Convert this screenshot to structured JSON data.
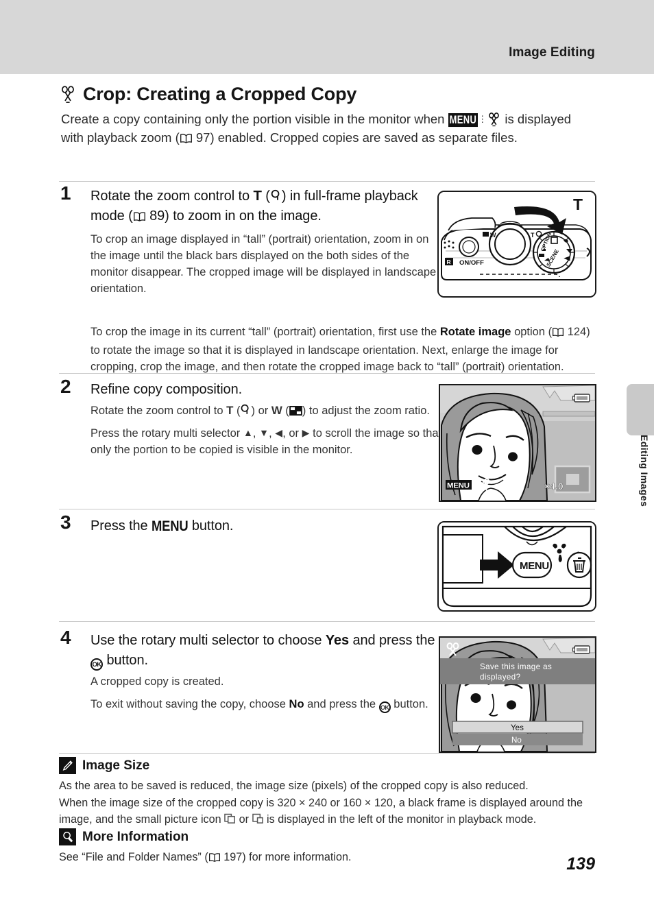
{
  "header": {
    "title": "Image Editing"
  },
  "side_tab": {
    "label": "Editing Images"
  },
  "section": {
    "icon": "scissors-icon",
    "title": "Crop: Creating a Cropped Copy",
    "intro_part1": "Create a copy containing only the portion visible in the monitor when ",
    "intro_part2": " is displayed with playback zoom (",
    "intro_page_ref": "97",
    "intro_part3": ") enabled. Cropped copies are saved as separate files."
  },
  "steps": [
    {
      "number": "1",
      "head_a": "Rotate the zoom control to ",
      "head_T": "T",
      "head_b": " (",
      "head_zoomicon": "magnifier-icon",
      "head_c": ") in full-frame playback mode (",
      "head_page_ref": "89",
      "head_d": ") to zoom in on the image.",
      "paras": [
        "To crop an image displayed in “tall” (portrait) orientation, zoom in on the image until the black bars displayed on the both sides of the monitor disappear. The cropped image will be displayed in landscape orientation.",
        "To crop the image in its current “tall” (portrait) orientation, first use the Rotate image option (\u0001 124) to rotate the image so that it is displayed in landscape orientation. Next, enlarge the image for cropping, crop the image, and then rotate the cropped image back to “tall” (portrait) orientation."
      ],
      "para2_bold": "Rotate image",
      "para2_page_ref": "124",
      "figure": {
        "name": "camera-top-zoom-control",
        "label_T": "T",
        "onoff_label": "ON/OFF",
        "mode_dial_label": "SCENE"
      }
    },
    {
      "number": "2",
      "head": "Refine copy composition.",
      "para1_a": "Rotate the zoom control to ",
      "para1_T": "T",
      "para1_b": " (",
      "para1_c": ") or ",
      "para1_W": "W",
      "para1_d": " (",
      "para1_e": ") to adjust the zoom ratio.",
      "para2_a": "Press the rotary multi selector ",
      "para2_b": ", ",
      "para2_c": ", ",
      "para2_d": ", or ",
      "para2_e": " to scroll the image so that only the portion to be copied is visible in the monitor.",
      "figure": {
        "name": "monitor-playback-zoom",
        "menu_badge": "MENU",
        "crop_icon": "scissors-icon",
        "zoom_ratio": "×4.0",
        "battery_icon": "battery-icon",
        "nav_thumb": "zoom-position-indicator"
      }
    },
    {
      "number": "3",
      "head_a": "Press the ",
      "head_menu": "MENU",
      "head_b": " button.",
      "figure": {
        "name": "camera-back-menu-button",
        "menu_button": "MENU",
        "macro_icon": "macro-flower-icon",
        "delete_icon": "trash-icon",
        "arrow": "right-arrow-icon"
      }
    },
    {
      "number": "4",
      "head_a": "Use the rotary multi selector to choose ",
      "head_yes": "Yes",
      "head_b": " and press the ",
      "head_ok": "OK",
      "head_c": " button.",
      "para1": "A cropped copy is created.",
      "para2_a": "To exit without saving the copy, choose ",
      "para2_no": "No",
      "para2_b": " and press the ",
      "para2_c": " button.",
      "figure": {
        "name": "monitor-save-confirm-dialog",
        "prompt_line1": "Save this image as",
        "prompt_line2": "displayed?",
        "option_yes": "Yes",
        "option_no": "No",
        "crop_icon": "scissors-icon",
        "battery_icon": "battery-icon"
      }
    }
  ],
  "notes": [
    {
      "badge": "pencil-icon",
      "title": "Image Size",
      "line1": "As the area to be saved is reduced, the image size (pixels) of the cropped copy is also reduced.",
      "line2_a": "When the image size of the cropped copy is 320 × 240 or 160 × 120, a black frame is displayed around the image, and the small picture icon ",
      "line2_b": " or ",
      "line2_c": " is displayed in the left of the monitor in playback mode."
    },
    {
      "badge": "magnifier-icon",
      "title": "More Information",
      "line_a": "See “File and Folder Names” (",
      "line_page_ref": "197",
      "line_b": ") for more information."
    }
  ],
  "footer": {
    "page_number": "139"
  }
}
